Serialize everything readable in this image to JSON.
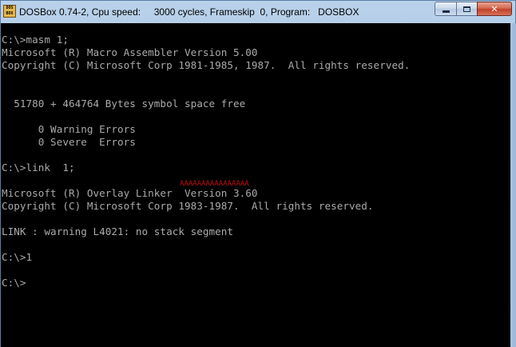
{
  "window": {
    "title": "DOSBox 0.74-2, Cpu speed:     3000 cycles, Frameskip  0, Program:   DOSBOX",
    "icon": "dosbox-icon",
    "icon_text": "DOS BOX",
    "controls": {
      "minimize": "minimize-icon",
      "maximize": "maximize-icon",
      "close": "close-icon",
      "close_glyph": "✕"
    },
    "close_color": "#c24129"
  },
  "console": {
    "text_color": "#aaaaaa",
    "background": "#000000",
    "lines": [
      "C:\\>masm 1;",
      "Microsoft (R) Macro Assembler Version 5.00",
      "Copyright (C) Microsoft Corp 1981-1985, 1987.  All rights reserved.",
      "",
      "",
      "  51780 + 464764 Bytes symbol space free",
      "",
      "      0 Warning Errors",
      "      0 Severe  Errors",
      "",
      "C:\\>link  1;",
      "",
      "Microsoft (R) Overlay Linker  Version 3.60",
      "Copyright (C) Microsoft Corp 1983-1987.  All rights reserved.",
      "",
      "LINK : warning L4021: no stack segment",
      "",
      "C:\\>1",
      "",
      "C:\\>"
    ],
    "marker_text": "AAAAAAAAAAAAAAAA",
    "marker_color": "#c01010"
  }
}
